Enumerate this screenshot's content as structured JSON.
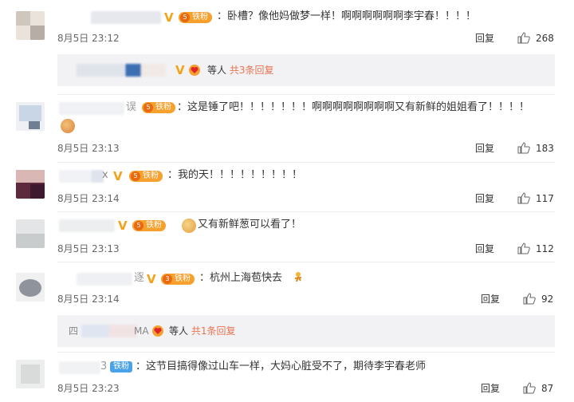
{
  "comments": [
    {
      "text": "：卧槽？像他妈做梦一样！啊啊啊啊啊啊李宇春！！！！",
      "time": "8月5日 23:12",
      "reply_label": "回复",
      "likes": "268",
      "fan_badge": "铁粉",
      "fan_level": "5"
    },
    {
      "text": "：这是锤了吧！！！！！！！啊啊啊啊啊啊啊啊又有新鲜的姐姐看了！！！！",
      "time": "8月5日 23:13",
      "reply_label": "回复",
      "likes": "183",
      "fan_badge": "铁粉",
      "fan_level": "5"
    },
    {
      "text": "：我的天！！！！！！！！！",
      "time": "8月5日 23:14",
      "reply_label": "回复",
      "likes": "117",
      "fan_badge": "铁粉",
      "fan_level": "5"
    },
    {
      "text": "又有新鲜葱可以看了！",
      "time": "8月5日 23:13",
      "reply_label": "回复",
      "likes": "112",
      "fan_badge": "铁粉",
      "fan_level": "5"
    },
    {
      "text": "：杭州上海苞快去",
      "time": "8月5日 23:14",
      "reply_label": "回复",
      "likes": "92",
      "fan_badge": "铁粉",
      "fan_level": "3"
    },
    {
      "text": "：这节目搞得像过山车一样，大妈心脏受不了，期待李宇春老师",
      "time": "8月5日 23:23",
      "reply_label": "回复",
      "likes": "87",
      "fan_badge": "铁粉"
    }
  ],
  "sub_replies": [
    {
      "others": "等人",
      "link": "共3条回复"
    },
    {
      "others": "等人",
      "link": "共1条回复"
    }
  ],
  "partial_names": {
    "c2": "误",
    "c3": "x",
    "c5": "逐",
    "c6": "3",
    "s2a": "四",
    "s2b": "MA"
  },
  "vbadge": "V",
  "colors": {
    "fan_badge": "#f6a02e",
    "link": "#eb7350",
    "v_badge": "#f3a21a"
  },
  "icons": [
    "thumbs-up-icon",
    "heart-badge-icon",
    "v-badge-icon"
  ]
}
